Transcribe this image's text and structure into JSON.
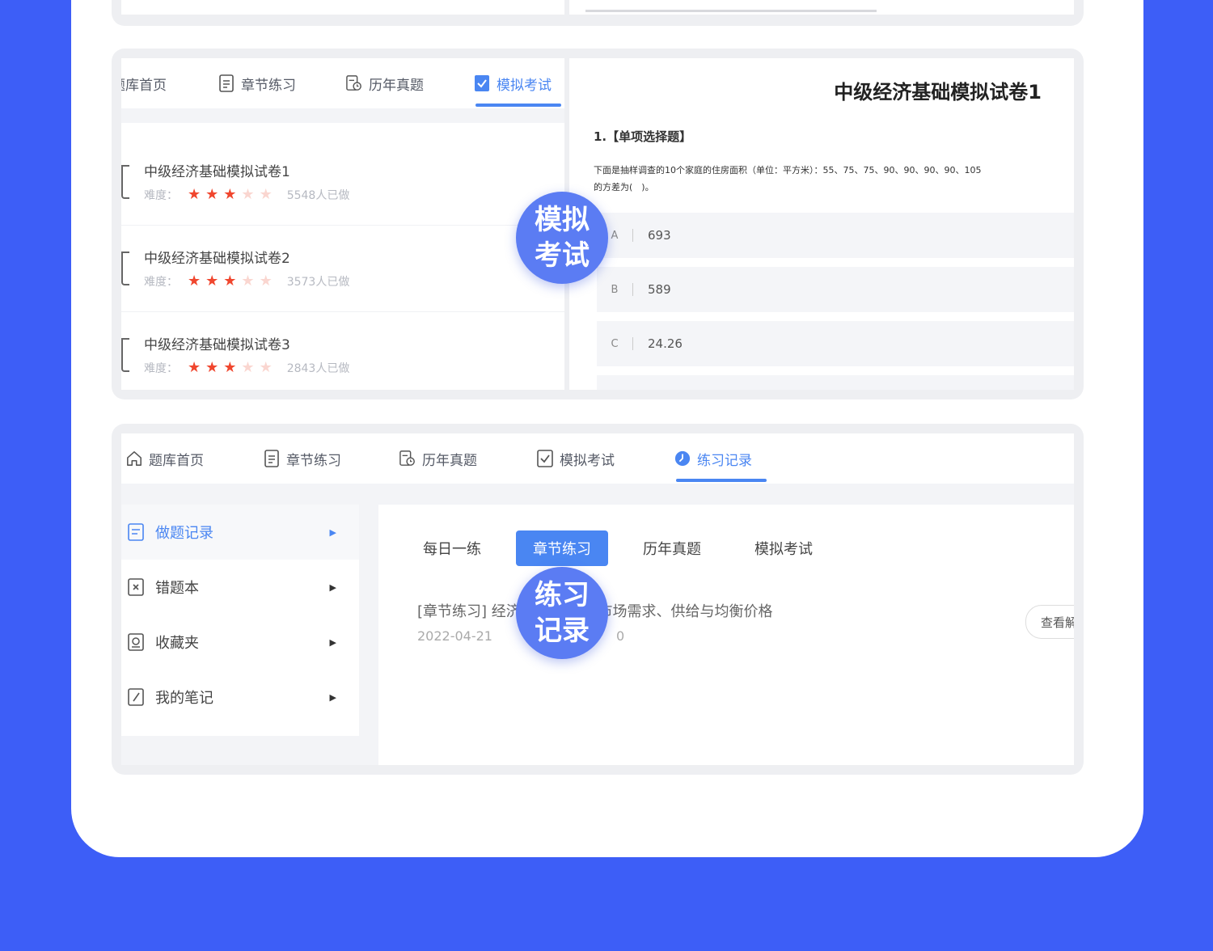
{
  "colors": {
    "background": "#3d5ef7",
    "accent": "#4a86f2",
    "star_on": "#f0462e",
    "star_off": "#fad6d0",
    "badge": "#5b7cf3"
  },
  "exam_panel": {
    "tabs": [
      {
        "label": "题库首页",
        "icon": "home-icon"
      },
      {
        "label": "章节练习",
        "icon": "document-icon"
      },
      {
        "label": "历年真题",
        "icon": "history-doc-icon"
      },
      {
        "label": "模拟考试",
        "icon": "exam-check-icon",
        "active": true
      }
    ],
    "papers": [
      {
        "title": "中级经济基础模拟试卷1",
        "difficulty_label": "难度：",
        "stars": 3,
        "max_stars": 5,
        "done": "5548人已做"
      },
      {
        "title": "中级经济基础模拟试卷2",
        "difficulty_label": "难度：",
        "stars": 3,
        "max_stars": 5,
        "done": "3573人已做"
      },
      {
        "title": "中级经济基础模拟试卷3",
        "difficulty_label": "难度：",
        "stars": 3,
        "max_stars": 5,
        "done": "2843人已做"
      }
    ],
    "paper_title": "中级经济基础模拟试卷1",
    "question": {
      "heading": "1.【单项选择题】",
      "text": "下面是抽样调查的10个家庭的住房面积（单位：平方米）：55、75、75、90、90、90、90、105",
      "text2": "的方差为(　)。",
      "options": [
        {
          "letter": "A",
          "value": "693"
        },
        {
          "letter": "B",
          "value": "589"
        },
        {
          "letter": "C",
          "value": "24.26"
        }
      ]
    },
    "badge": [
      "模拟",
      "考试"
    ]
  },
  "record_panel": {
    "tabs": [
      {
        "label": "题库首页",
        "icon": "home-icon"
      },
      {
        "label": "章节练习",
        "icon": "document-icon"
      },
      {
        "label": "历年真题",
        "icon": "history-doc-icon"
      },
      {
        "label": "模拟考试",
        "icon": "exam-check-icon"
      },
      {
        "label": "练习记录",
        "icon": "record-clock-icon",
        "active": true
      }
    ],
    "menu": [
      {
        "label": "做题记录",
        "icon": "record-list-icon",
        "active": true
      },
      {
        "label": "错题本",
        "icon": "wrong-book-icon"
      },
      {
        "label": "收藏夹",
        "icon": "favorite-folder-icon"
      },
      {
        "label": "我的笔记",
        "icon": "notes-icon"
      }
    ],
    "subtabs": [
      {
        "label": "每日一练"
      },
      {
        "label": "章节练习",
        "active": true
      },
      {
        "label": "历年真题"
      },
      {
        "label": "模拟考试"
      }
    ],
    "record": {
      "title": "[章节练习] 经济基础第一章 市场需求、供给与均衡价格",
      "date": "2022-04-21",
      "score": "0",
      "action": "查看解析"
    },
    "badge": [
      "练习",
      "记录"
    ]
  }
}
